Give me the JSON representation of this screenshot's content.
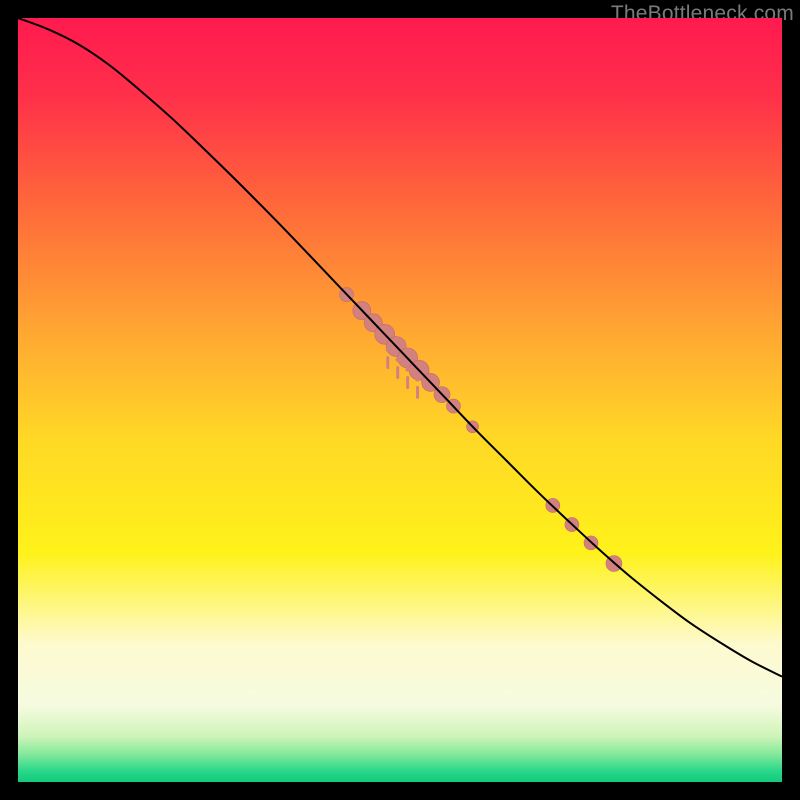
{
  "watermark": "TheBottleneck.com",
  "chart_data": {
    "type": "line",
    "title": "",
    "xlabel": "",
    "ylabel": "",
    "xlim": [
      0,
      100
    ],
    "ylim": [
      0,
      100
    ],
    "background_gradient": {
      "stops": [
        {
          "offset": 0.0,
          "color": "#ff1a4f"
        },
        {
          "offset": 0.1,
          "color": "#ff2f4a"
        },
        {
          "offset": 0.25,
          "color": "#ff6a3a"
        },
        {
          "offset": 0.4,
          "color": "#ffa333"
        },
        {
          "offset": 0.55,
          "color": "#ffd826"
        },
        {
          "offset": 0.7,
          "color": "#fff21a"
        },
        {
          "offset": 0.82,
          "color": "#fdfacf"
        },
        {
          "offset": 0.9,
          "color": "#f6fbe0"
        },
        {
          "offset": 0.94,
          "color": "#cff4b9"
        },
        {
          "offset": 0.965,
          "color": "#7fe89a"
        },
        {
          "offset": 0.985,
          "color": "#2bd88a"
        },
        {
          "offset": 1.0,
          "color": "#12c97e"
        }
      ]
    },
    "series": [
      {
        "name": "curve",
        "type": "line",
        "stroke": "#000000",
        "stroke_width": 2,
        "points": [
          {
            "x": 0.0,
            "y": 100.0
          },
          {
            "x": 4.0,
            "y": 98.5
          },
          {
            "x": 8.0,
            "y": 96.5
          },
          {
            "x": 12.0,
            "y": 93.8
          },
          {
            "x": 16.0,
            "y": 90.5
          },
          {
            "x": 20.0,
            "y": 87.0
          },
          {
            "x": 24.0,
            "y": 83.2
          },
          {
            "x": 28.0,
            "y": 79.3
          },
          {
            "x": 32.0,
            "y": 75.3
          },
          {
            "x": 36.0,
            "y": 71.2
          },
          {
            "x": 40.0,
            "y": 67.0
          },
          {
            "x": 44.0,
            "y": 62.8
          },
          {
            "x": 48.0,
            "y": 58.6
          },
          {
            "x": 52.0,
            "y": 54.4
          },
          {
            "x": 56.0,
            "y": 50.2
          },
          {
            "x": 60.0,
            "y": 46.0
          },
          {
            "x": 64.0,
            "y": 42.0
          },
          {
            "x": 68.0,
            "y": 38.0
          },
          {
            "x": 72.0,
            "y": 34.2
          },
          {
            "x": 76.0,
            "y": 30.5
          },
          {
            "x": 80.0,
            "y": 27.0
          },
          {
            "x": 84.0,
            "y": 23.8
          },
          {
            "x": 88.0,
            "y": 20.8
          },
          {
            "x": 92.0,
            "y": 18.2
          },
          {
            "x": 96.0,
            "y": 15.8
          },
          {
            "x": 100.0,
            "y": 13.8
          }
        ]
      },
      {
        "name": "cluster-markers",
        "type": "scatter",
        "fill": "#d3817f",
        "stroke": "#bb6d6b",
        "points": [
          {
            "x": 43.0,
            "y": 63.8,
            "r": 7
          },
          {
            "x": 45.0,
            "y": 61.7,
            "r": 9
          },
          {
            "x": 46.5,
            "y": 60.1,
            "r": 9
          },
          {
            "x": 48.0,
            "y": 58.6,
            "r": 10
          },
          {
            "x": 49.5,
            "y": 57.0,
            "r": 10
          },
          {
            "x": 51.0,
            "y": 55.5,
            "r": 10
          },
          {
            "x": 52.5,
            "y": 53.9,
            "r": 10
          },
          {
            "x": 54.0,
            "y": 52.3,
            "r": 9
          },
          {
            "x": 55.5,
            "y": 50.7,
            "r": 8
          },
          {
            "x": 57.0,
            "y": 49.2,
            "r": 7
          },
          {
            "x": 59.5,
            "y": 46.5,
            "r": 6
          },
          {
            "x": 70.0,
            "y": 36.2,
            "r": 7
          },
          {
            "x": 72.5,
            "y": 33.7,
            "r": 7
          },
          {
            "x": 75.0,
            "y": 31.3,
            "r": 7
          },
          {
            "x": 78.0,
            "y": 28.6,
            "r": 8
          }
        ]
      },
      {
        "name": "cluster-ticks",
        "type": "scatter",
        "fill": "#d3817f",
        "points": [
          {
            "x": 48.4,
            "y": 56.6,
            "r": 2.2
          },
          {
            "x": 49.7,
            "y": 55.3,
            "r": 2.2
          },
          {
            "x": 51.0,
            "y": 54.0,
            "r": 2.2
          },
          {
            "x": 52.3,
            "y": 52.7,
            "r": 2.2
          }
        ]
      }
    ]
  }
}
